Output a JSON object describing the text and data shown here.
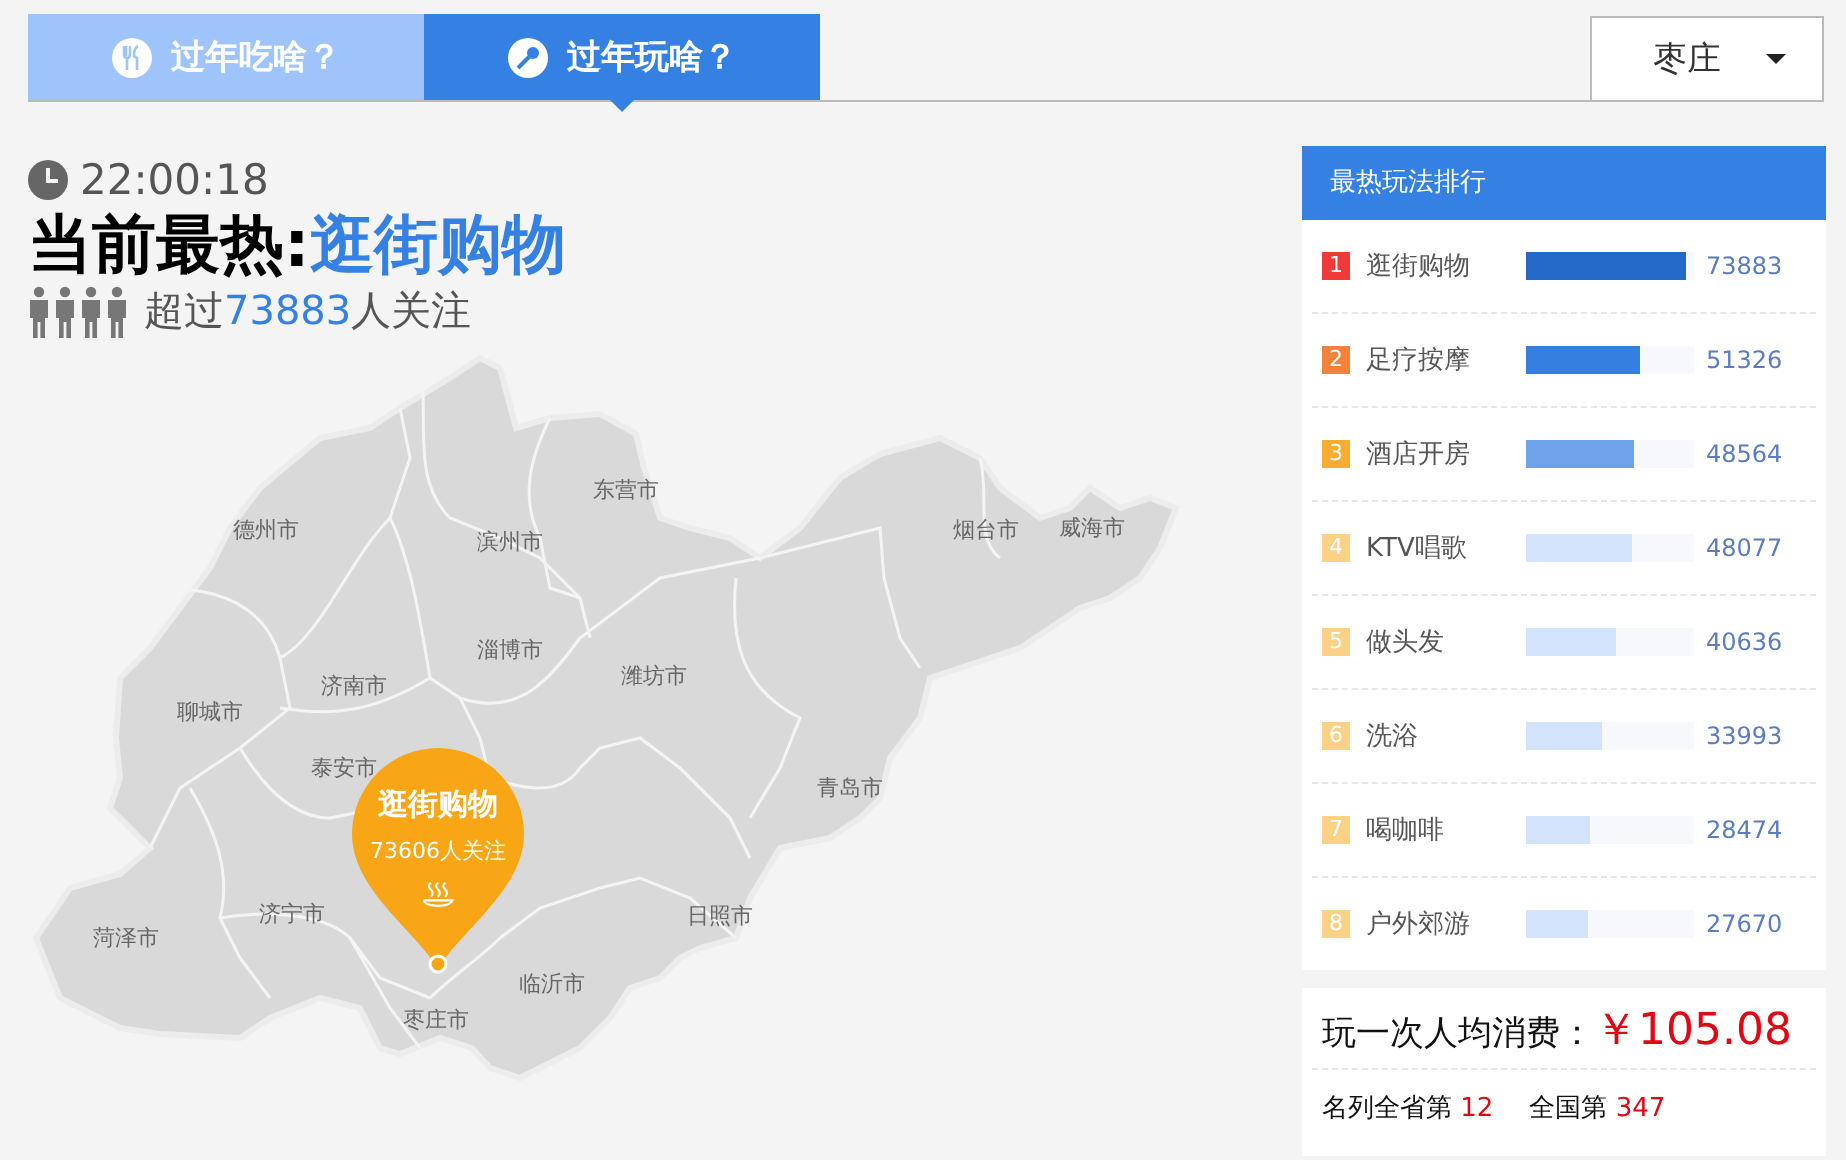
{
  "tabs": [
    {
      "label": "过年吃啥？",
      "selected": false
    },
    {
      "label": "过年玩啥？",
      "selected": true
    }
  ],
  "city_select": {
    "value": "枣庄"
  },
  "clock": {
    "time": "22:00:18"
  },
  "headline": {
    "prefix": "当前最热:",
    "hot": "逛街购物"
  },
  "followers": {
    "prefix": "超过",
    "count": "73883",
    "suffix": "人关注"
  },
  "map": {
    "cities": [
      "德州市",
      "滨州市",
      "东营市",
      "烟台市",
      "威海市",
      "淄博市",
      "潍坊市",
      "济南市",
      "聊城市",
      "泰安市",
      "青岛市",
      "济宁市",
      "日照市",
      "菏泽市",
      "临沂市",
      "枣庄市"
    ],
    "pin": {
      "title": "逛街购物",
      "subtitle": "73606人关注"
    }
  },
  "ranking": {
    "title": "最热玩法排行",
    "items": [
      {
        "rank": "1",
        "name": "逛街购物",
        "value": "73883",
        "level": 0.95,
        "color": "#f03a3a"
      },
      {
        "rank": "2",
        "name": "足疗按摩",
        "value": "51326",
        "level": 0.68,
        "color": "#f5813a"
      },
      {
        "rank": "3",
        "name": "酒店开房",
        "value": "48564",
        "level": 0.64,
        "color": "#f9ac32"
      },
      {
        "rank": "4",
        "name": "KTV唱歌",
        "value": "48077",
        "level": 0.63,
        "color": "#fbd185"
      },
      {
        "rank": "5",
        "name": "做头发",
        "value": "40636",
        "level": 0.54,
        "color": "#fbd185"
      },
      {
        "rank": "6",
        "name": "洗浴",
        "value": "33993",
        "level": 0.45,
        "color": "#fbd185"
      },
      {
        "rank": "7",
        "name": "喝咖啡",
        "value": "28474",
        "level": 0.38,
        "color": "#fbd185"
      },
      {
        "rank": "8",
        "name": "户外郊游",
        "value": "27670",
        "level": 0.37,
        "color": "#fbd185"
      }
    ]
  },
  "cost": {
    "label": "玩一次人均消费：",
    "amount": "￥105.08",
    "province_label": "名列全省第",
    "province_rank": "12",
    "country_label": "全国第",
    "country_rank": "347"
  }
}
